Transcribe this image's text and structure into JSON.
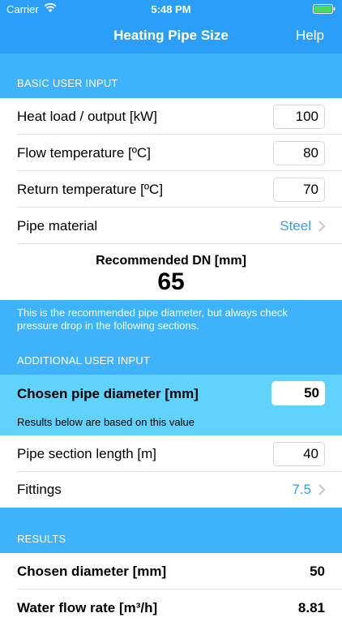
{
  "status_bar": {
    "carrier": "Carrier",
    "time": "5:48 PM"
  },
  "nav": {
    "title": "Heating Pipe Size",
    "help_label": "Help"
  },
  "basic": {
    "header": "BASIC USER INPUT",
    "heat_load": {
      "label": "Heat load / output [kW]",
      "value": "100"
    },
    "flow_temp": {
      "label": "Flow temperature [ºC]",
      "value": "80"
    },
    "return_temp": {
      "label": "Return temperature [ºC]",
      "value": "70"
    },
    "pipe_material": {
      "label": "Pipe material",
      "value": "Steel"
    }
  },
  "recommended": {
    "label": "Recommended DN [mm]",
    "value": "65"
  },
  "note": "This is the recommended pipe diameter, but always check pressure drop in the following sections.",
  "additional": {
    "header": "ADDITIONAL USER INPUT",
    "chosen_diameter": {
      "label": "Chosen pipe diameter [mm]",
      "value": "50",
      "sub": "Results below are based on this value"
    },
    "section_length": {
      "label": "Pipe section length [m]",
      "value": "40"
    },
    "fittings": {
      "label": "Fittings",
      "value": "7.5"
    }
  },
  "results": {
    "header": "RESULTS",
    "rows": [
      {
        "label": "Chosen diameter [mm]",
        "value": "50"
      },
      {
        "label": "Water flow rate [m³/h]",
        "value": "8.81"
      }
    ]
  },
  "colors": {
    "nav_blue": "#2b9ff8",
    "section_blue": "#3eb2fb",
    "highlight_cyan": "#5fd3fb",
    "link_blue": "#3a9ee6"
  },
  "icons": {
    "wifi": "wifi-icon",
    "battery": "battery-icon",
    "chevron": "chevron-right-icon"
  }
}
